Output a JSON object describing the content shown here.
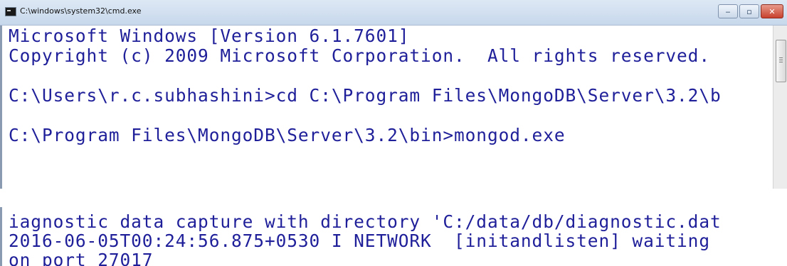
{
  "window": {
    "title": "C:\\windows\\system32\\cmd.exe",
    "icon": "console-icon",
    "buttons": {
      "minimize": "‒",
      "maximize": "▫",
      "close": "✕"
    }
  },
  "console": {
    "lines": [
      "Microsoft Windows [Version 6.1.7601]",
      "Copyright (c) 2009 Microsoft Corporation.  All rights reserved.",
      "",
      "C:\\Users\\r.c.subhashini>cd C:\\Program Files\\MongoDB\\Server\\3.2\\b",
      "",
      "C:\\Program Files\\MongoDB\\Server\\3.2\\bin>mongod.exe"
    ]
  },
  "console2": {
    "lines": [
      "iagnostic data capture with directory 'C:/data/db/diagnostic.dat",
      "2016-06-05T00:24:56.875+0530 I NETWORK  [initandlisten] waiting",
      "on port 27017"
    ]
  },
  "colors": {
    "text": "#1f1f9a",
    "background": "#ffffff",
    "titlebar": "#c7d8ec"
  }
}
